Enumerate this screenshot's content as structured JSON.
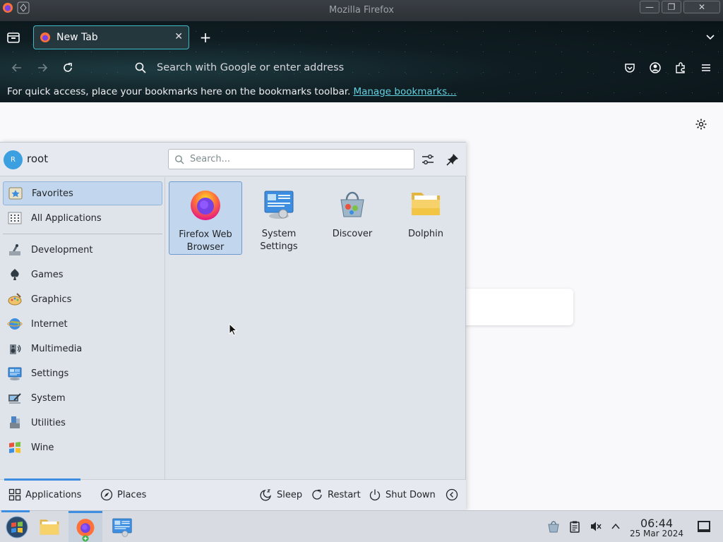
{
  "window": {
    "title": "Mozilla Firefox",
    "buttons": {
      "minimize": "—",
      "maximize": "❐",
      "close": "✕"
    }
  },
  "firefox": {
    "tabs": [
      {
        "label": "New Tab",
        "active": true
      }
    ],
    "urlbar_placeholder": "Search with Google or enter address",
    "bookmarks_bar": {
      "text": "For quick access, place your bookmarks here on the bookmarks toolbar.",
      "link": "Manage bookmarks…"
    }
  },
  "launcher": {
    "user": {
      "initial": "R",
      "name": "root"
    },
    "search_placeholder": "Search...",
    "categories": [
      {
        "label": "Favorites",
        "icon": "favorites-icon",
        "selected": true
      },
      {
        "label": "All Applications",
        "icon": "all-applications-icon"
      },
      {
        "label": "Development",
        "icon": "development-icon"
      },
      {
        "label": "Games",
        "icon": "games-icon"
      },
      {
        "label": "Graphics",
        "icon": "graphics-icon"
      },
      {
        "label": "Internet",
        "icon": "internet-icon"
      },
      {
        "label": "Multimedia",
        "icon": "multimedia-icon"
      },
      {
        "label": "Settings",
        "icon": "settings-icon"
      },
      {
        "label": "System",
        "icon": "system-icon"
      },
      {
        "label": "Utilities",
        "icon": "utilities-icon"
      },
      {
        "label": "Wine",
        "icon": "wine-icon"
      }
    ],
    "favorites": [
      {
        "label": "Firefox Web Browser",
        "icon": "firefox-icon",
        "selected": true
      },
      {
        "label": "System Settings",
        "icon": "system-settings-icon"
      },
      {
        "label": "Discover",
        "icon": "discover-icon"
      },
      {
        "label": "Dolphin",
        "icon": "dolphin-folder-icon"
      }
    ],
    "footer": {
      "applications": "Applications",
      "places": "Places",
      "sleep": "Sleep",
      "restart": "Restart",
      "shutdown": "Shut Down"
    }
  },
  "taskbar": {
    "tasks": [
      "start-menu-icon",
      "dolphin-folder-icon",
      "firefox-icon",
      "system-settings-icon"
    ],
    "clock": {
      "time": "06:44",
      "date": "25 Mar 2024"
    }
  },
  "colors": {
    "accent": "#3d8ee0",
    "selection": "#c2d6ee",
    "link": "#62d1e0"
  }
}
